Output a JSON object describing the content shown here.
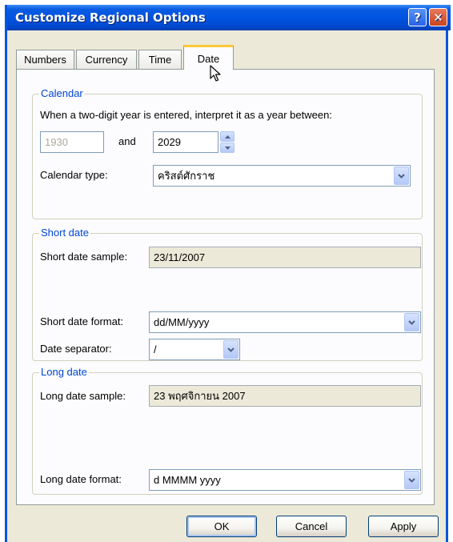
{
  "window": {
    "title": "Customize Regional Options",
    "help_button": "?",
    "close_button": "✕"
  },
  "tabs": [
    {
      "label": "Numbers",
      "active": false
    },
    {
      "label": "Currency",
      "active": false
    },
    {
      "label": "Time",
      "active": false
    },
    {
      "label": "Date",
      "active": true
    }
  ],
  "calendar": {
    "legend": "Calendar",
    "instruction": "When a two-digit year is entered, interpret it as a year between:",
    "year_from": "1930",
    "and_label": "and",
    "year_to": "2029",
    "type_label": "Calendar type:",
    "type_value": "คริสต์ศักราช"
  },
  "short_date": {
    "legend": "Short date",
    "sample_label": "Short date sample:",
    "sample_value": "23/11/2007",
    "format_label": "Short date format:",
    "format_value": "dd/MM/yyyy",
    "separator_label": "Date separator:",
    "separator_value": "/"
  },
  "long_date": {
    "legend": "Long date",
    "sample_label": "Long date sample:",
    "sample_value": "23 พฤศจิกายน 2007",
    "format_label": "Long date format:",
    "format_value": "d MMMM yyyy"
  },
  "buttons": {
    "ok": "OK",
    "cancel": "Cancel",
    "apply": "Apply"
  },
  "icons": {
    "dropdown": "chevron-down-icon",
    "spin_up": "arrow-up-icon",
    "spin_down": "arrow-down-icon",
    "cursor": "mouse-pointer-icon"
  },
  "colors": {
    "titlebar": "#0054e3",
    "active_tab_highlight": "#ffc83c",
    "group_legend": "#0046d5",
    "dialog_face": "#ece9d8"
  }
}
